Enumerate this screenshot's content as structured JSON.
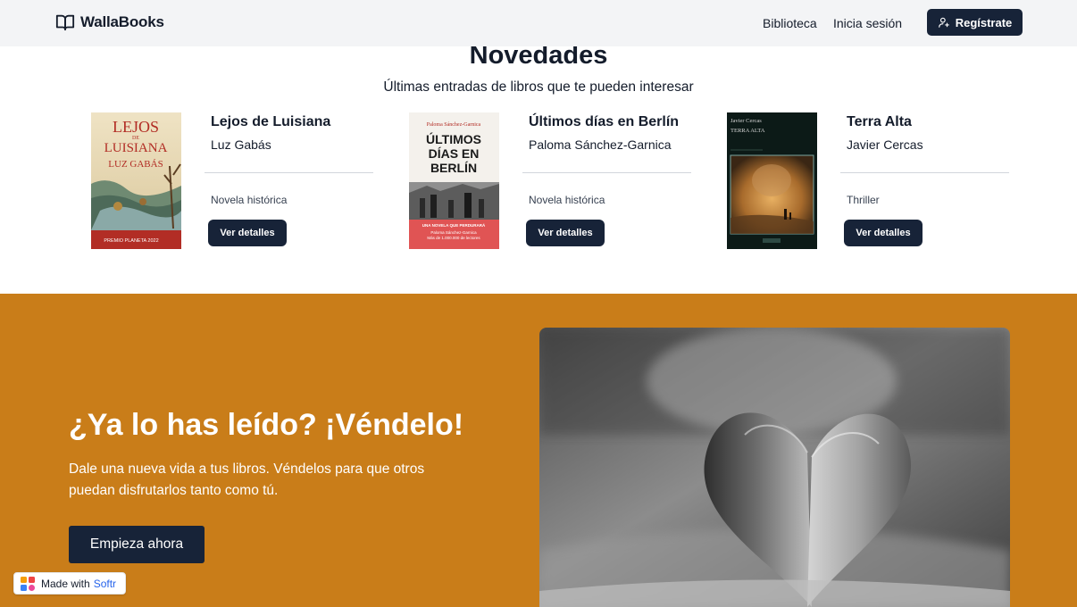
{
  "nav": {
    "brand": "WallaBooks",
    "links": [
      "Biblioteca",
      "Inicia sesión"
    ],
    "register_label": "Regístrate"
  },
  "novedades": {
    "title": "Novedades",
    "subtitle": "Últimas entradas de libros que te pueden interesar",
    "books": [
      {
        "title": "Lejos de Luisiana",
        "author": "Luz Gabás",
        "genre": "Novela histórica",
        "button": "Ver detalles",
        "cover": {
          "line1": "LEJOS",
          "small": "DE",
          "line2": "LUISIANA",
          "author": "LUZ GABÁS",
          "band": "PREMIO PLANETA 2022",
          "colors": {
            "bg": "#e8d9b5",
            "band": "#b22d25"
          }
        }
      },
      {
        "title": "Últimos días en Berlín",
        "author": "Paloma Sánchez-Garnica",
        "genre": "Novela histórica",
        "button": "Ver detalles",
        "cover": {
          "author": "Paloma Sánchez-Garnica",
          "line1": "ÚLTIMOS",
          "line2": "DÍAS EN",
          "line3": "BERLÍN",
          "band1": "UNA NOVELA QUE PERDURARÁ",
          "band2": "Paloma Sánchez-Garnica",
          "band3": "Más de 1.000.000 de lectores",
          "colors": {
            "bg": "#f4f1ec",
            "band": "#e05454"
          }
        }
      },
      {
        "title": "Terra Alta",
        "author": "Javier Cercas",
        "genre": "Thriller",
        "button": "Ver detalles",
        "cover": {
          "author": "Javier Cercas",
          "title": "TERRA ALTA",
          "colors": {
            "bg": "#0c1a17",
            "art": "#c48a3a"
          }
        }
      }
    ]
  },
  "sell": {
    "title": "¿Ya lo has leído? ¡Véndelo!",
    "text": "Dale una nueva vida a tus libros. Véndelos para que otros puedan disfrutarlos tanto como tú.",
    "button": "Empieza ahora",
    "colors": {
      "bg": "#c97d19"
    }
  },
  "badge": {
    "made_with": "Made with",
    "brand": "Softr"
  },
  "colors": {
    "dark_button": "#172338",
    "navbar": "#f3f4f6"
  }
}
